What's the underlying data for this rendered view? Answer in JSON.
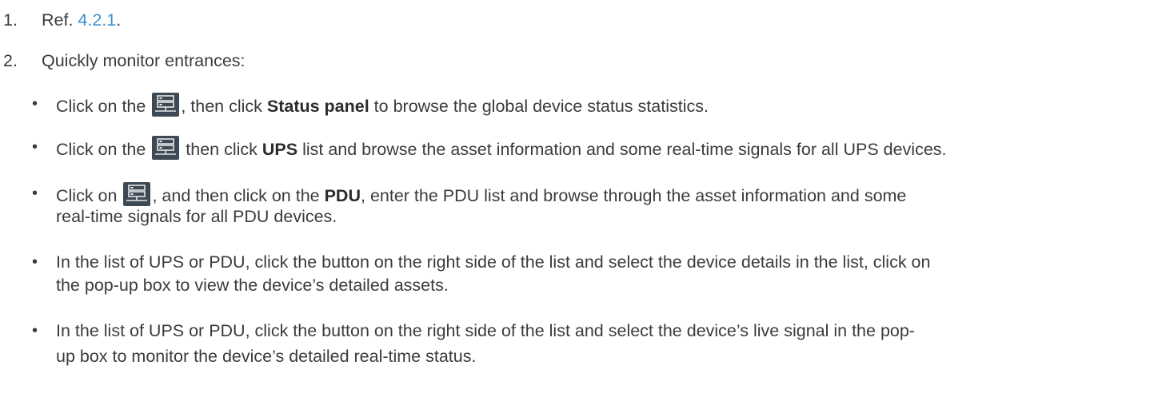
{
  "steps": [
    {
      "number": "1.",
      "prefix": "Ref. ",
      "link": "4.2.1",
      "suffix": "."
    },
    {
      "number": "2.",
      "text": "Quickly monitor entrances:",
      "bullets": [
        {
          "pre": "Click on the ",
          "icon": "server-list-icon",
          "mid": ", then click ",
          "bold": "Status panel",
          "post": " to browse the global device status statistics."
        },
        {
          "pre": "Click on the ",
          "icon": "server-list-icon",
          "mid": " then click ",
          "bold": "UPS",
          "post": " list and browse the asset information and some real-time signals for all UPS devices."
        },
        {
          "pre": "Click on ",
          "icon": "server-list-icon",
          "mid": ", and then click on the ",
          "bold": "PDU",
          "post": ", enter the PDU list and browse through the asset information and some",
          "cont": "real-time signals for all PDU devices."
        },
        {
          "line1": "In the list of UPS or PDU, click the button on the right side of the list and select the device details in the list, click on",
          "line2": "the  pop-up box to view the device’s detailed assets."
        },
        {
          "line1": "In the list of UPS or PDU, click the button on the right side of the list and select the   device’s live signal in the pop-",
          "line2": "up box to monitor the device’s detailed real-time status."
        }
      ]
    }
  ],
  "colors": {
    "text": "#3b3b3b",
    "link": "#3f8fc9",
    "icon_bg": "#3d4a55",
    "icon_fg": "#e6e6e6"
  }
}
